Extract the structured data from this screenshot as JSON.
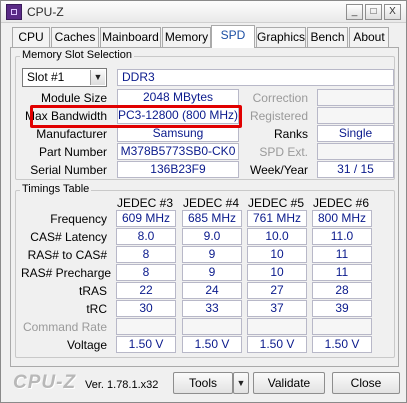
{
  "window": {
    "title": "CPU-Z",
    "minimize": "_",
    "maximize": "□",
    "close": "X"
  },
  "tabs": [
    {
      "label": "CPU"
    },
    {
      "label": "Caches"
    },
    {
      "label": "Mainboard"
    },
    {
      "label": "Memory"
    },
    {
      "label": "SPD",
      "active": true
    },
    {
      "label": "Graphics"
    },
    {
      "label": "Bench"
    },
    {
      "label": "About"
    }
  ],
  "slot_selection": {
    "title": "Memory Slot Selection",
    "slot": "Slot #1",
    "type": "DDR3",
    "module_size_label": "Module Size",
    "module_size": "2048 MBytes",
    "max_bandwidth_label": "Max Bandwidth",
    "max_bandwidth": "PC3-12800 (800 MHz)",
    "manufacturer_label": "Manufacturer",
    "manufacturer": "Samsung",
    "part_number_label": "Part Number",
    "part_number": "M378B5773SB0-CK0",
    "serial_number_label": "Serial Number",
    "serial_number": "136B23F9",
    "correction_label": "Correction",
    "correction": "",
    "registered_label": "Registered",
    "registered": "",
    "ranks_label": "Ranks",
    "ranks": "Single",
    "spd_ext_label": "SPD Ext.",
    "spd_ext": "",
    "week_year_label": "Week/Year",
    "week_year": "31 / 15"
  },
  "timings": {
    "title": "Timings Table",
    "columns": [
      "JEDEC #3",
      "JEDEC #4",
      "JEDEC #5",
      "JEDEC #6"
    ],
    "rows": [
      {
        "label": "Frequency",
        "values": [
          "609 MHz",
          "685 MHz",
          "761 MHz",
          "800 MHz"
        ]
      },
      {
        "label": "CAS# Latency",
        "values": [
          "8.0",
          "9.0",
          "10.0",
          "11.0"
        ]
      },
      {
        "label": "RAS# to CAS#",
        "values": [
          "8",
          "9",
          "10",
          "11"
        ]
      },
      {
        "label": "RAS# Precharge",
        "values": [
          "8",
          "9",
          "10",
          "11"
        ]
      },
      {
        "label": "tRAS",
        "values": [
          "22",
          "24",
          "27",
          "28"
        ]
      },
      {
        "label": "tRC",
        "values": [
          "30",
          "33",
          "37",
          "39"
        ]
      },
      {
        "label": "Command Rate",
        "values": [
          "",
          "",
          "",
          ""
        ],
        "disabled": true
      },
      {
        "label": "Voltage",
        "values": [
          "1.50 V",
          "1.50 V",
          "1.50 V",
          "1.50 V"
        ]
      }
    ]
  },
  "footer": {
    "brand": "CPU-Z",
    "version": "Ver. 1.78.1.x32",
    "tools": "Tools",
    "validate": "Validate",
    "close": "Close"
  },
  "colors": {
    "highlight": "#e10000",
    "value_text": "#0a1a8c",
    "active_tab": "#1c4fa4"
  }
}
